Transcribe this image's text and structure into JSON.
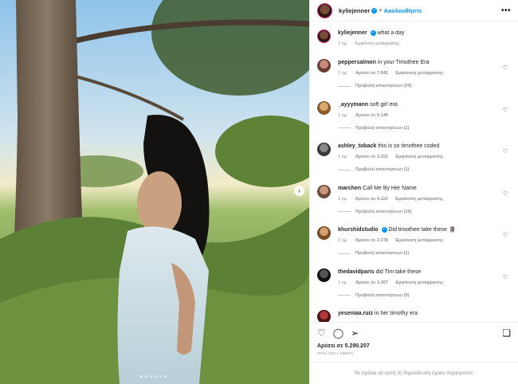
{
  "post": {
    "username": "kyliejenner",
    "follow_label": "Ακολουθήστε",
    "caption_text": "what a day",
    "caption_time": "1 ημ.",
    "caption_translate": "Εμφάνιση μετάφρασης",
    "likes": "Αρέσει σε 5.290.207",
    "timestamp": "ΠΡΙΝ ΑΠΟ 1 ΗΜΕΡΑ",
    "comments_limited": "Τα σχόλια σε αυτή τη δημοσίευση έχουν περιοριστεί."
  },
  "comments": [
    {
      "user": "peppersalmon",
      "text": "in your Timothee Era",
      "time": "1 ημ.",
      "likes": "Αρέσει σε 7.542",
      "translate": "Εμφάνιση μετάφρασης",
      "replies": "Προβολή απαντήσεων (29)"
    },
    {
      "user": "_ayyymann",
      "text": "soft girl era",
      "time": "1 ημ.",
      "likes": "Αρέσει σε 5.146",
      "translate": "",
      "replies": "Προβολή απαντήσεων (1)"
    },
    {
      "user": "ashley_toback",
      "text": "this is so timothee coded",
      "time": "1 ημ.",
      "likes": "Αρέσει σε 2.252",
      "translate": "Εμφάνιση μετάφρασης",
      "replies": "Προβολή απαντήσεων (1)"
    },
    {
      "user": "marchen",
      "text": "Call Me By Her Name",
      "time": "1 ημ.",
      "likes": "Αρέσει σε 4.119",
      "translate": "Εμφάνιση μετάφρασης",
      "replies": "Προβολή απαντήσεων (10)"
    },
    {
      "user": "khurshidstudio",
      "text": "Did timothee take these 🗿",
      "time": "1 ημ.",
      "likes": "Αρέσει σε 2.378",
      "translate": "Εμφάνιση μετάφρασης",
      "replies": "Προβολή απαντήσεων (1)"
    },
    {
      "user": "thedavidparis",
      "text": "did Tim take these",
      "time": "1 ημ.",
      "likes": "Αρέσει σε 2.367",
      "translate": "Εμφάνιση μετάφρασης",
      "replies": "Προβολή απαντήσεων (5)"
    },
    {
      "user": "yeseniaa.ruiz",
      "text": "in her timothy era",
      "time": "",
      "likes": "",
      "translate": "",
      "replies": ""
    }
  ],
  "icons": {
    "more": "more-options-icon",
    "heart": "heart-icon",
    "comment": "comment-icon",
    "share": "share-icon",
    "save": "bookmark-icon",
    "next": "chevron-right-icon",
    "verified": "verified-badge-icon"
  },
  "colors": {
    "accent": "#0095f6",
    "text": "#262626",
    "muted": "#8e8e8e",
    "border": "#efefef"
  },
  "carousel": {
    "slides": 6,
    "active": 1
  }
}
